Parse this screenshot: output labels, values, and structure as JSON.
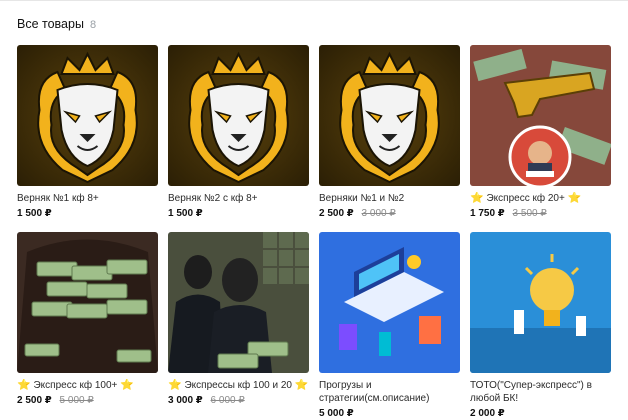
{
  "header": {
    "title": "Все товары",
    "count": "8"
  },
  "products": [
    {
      "name": "Верняк №1 кф 8+",
      "price": "1 500 ₽",
      "old_price": "",
      "star_before": "",
      "star_after": ""
    },
    {
      "name": "Верняк №2 с кф 8+",
      "price": "1 500 ₽",
      "old_price": "",
      "star_before": "",
      "star_after": ""
    },
    {
      "name": "Верняки №1 и №2",
      "price": "2 500 ₽",
      "old_price": "3 000 ₽",
      "star_before": "",
      "star_after": ""
    },
    {
      "name": "Экспресс кф 20+",
      "price": "1 750 ₽",
      "old_price": "3 500 ₽",
      "star_before": "⭐",
      "star_after": "⭐"
    },
    {
      "name": "Экспресс кф 100+",
      "price": "2 500 ₽",
      "old_price": "5 000 ₽",
      "star_before": "⭐",
      "star_after": "⭐"
    },
    {
      "name": "Экспрессы кф 100 и 20",
      "price": "3 000 ₽",
      "old_price": "6 000 ₽",
      "star_before": "⭐",
      "star_after": "⭐"
    },
    {
      "name": "Прогрузы и стратегии(см.описание)",
      "price": "5 000 ₽",
      "old_price": "",
      "star_before": "",
      "star_after": ""
    },
    {
      "name": "ТОТО(\"Супер-экспресс\") в любой БК!",
      "price": "2 000 ₽",
      "old_price": "",
      "star_before": "",
      "star_after": ""
    }
  ],
  "colors": {
    "lion_bg": "#3a2a06",
    "lion_gold": "#f2b21c",
    "cartoon_bg": "#9b1c1c",
    "money_bg": "#3b2a22",
    "robbers_bg": "#4a4f3d",
    "iso_bg": "#2f6fe0",
    "bulb_bg": "#2a8fd8"
  },
  "icons": [
    "lion-crown-logo-icon",
    "cash-gun-cartoon-icon",
    "money-bag-icon",
    "masked-robbers-icon",
    "isometric-laptop-icon",
    "lightbulb-icon"
  ]
}
